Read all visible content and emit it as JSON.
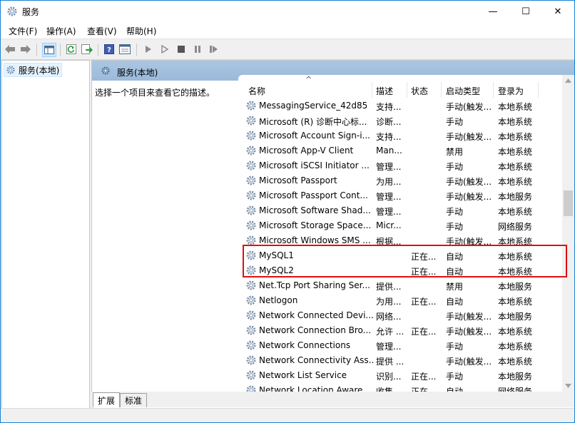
{
  "window": {
    "title": "服务",
    "minimize_glyph": "—",
    "maximize_glyph": "☐",
    "close_glyph": "✕"
  },
  "menu": [
    "文件(F)",
    "操作(A)",
    "查看(V)",
    "帮助(H)"
  ],
  "tree": {
    "item": "服务(本地)"
  },
  "pane": {
    "header": "服务(本地)",
    "description": "选择一个项目来查看它的描述。"
  },
  "columns": {
    "name": "名称",
    "desc": "描述",
    "status": "状态",
    "startup": "启动类型",
    "login": "登录为",
    "sort_glyph": "^"
  },
  "services": [
    {
      "name": "MessagingService_42d85",
      "desc": "支持...",
      "status": "",
      "startup": "手动(触发...",
      "login": "本地系统"
    },
    {
      "name": "Microsoft (R) 诊断中心标...",
      "desc": "诊断...",
      "status": "",
      "startup": "手动",
      "login": "本地系统"
    },
    {
      "name": "Microsoft Account Sign-i...",
      "desc": "支持...",
      "status": "",
      "startup": "手动(触发...",
      "login": "本地系统"
    },
    {
      "name": "Microsoft App-V Client",
      "desc": "Man...",
      "status": "",
      "startup": "禁用",
      "login": "本地系统"
    },
    {
      "name": "Microsoft iSCSI Initiator ...",
      "desc": "管理...",
      "status": "",
      "startup": "手动",
      "login": "本地系统"
    },
    {
      "name": "Microsoft Passport",
      "desc": "为用...",
      "status": "",
      "startup": "手动(触发...",
      "login": "本地系统"
    },
    {
      "name": "Microsoft Passport Cont...",
      "desc": "管理...",
      "status": "",
      "startup": "手动(触发...",
      "login": "本地服务"
    },
    {
      "name": "Microsoft Software Shad...",
      "desc": "管理...",
      "status": "",
      "startup": "手动",
      "login": "本地系统"
    },
    {
      "name": "Microsoft Storage Space...",
      "desc": "Micr...",
      "status": "",
      "startup": "手动",
      "login": "网络服务"
    },
    {
      "name": "Microsoft Windows SMS ...",
      "desc": "根据...",
      "status": "",
      "startup": "手动(触发...",
      "login": "本地系统"
    },
    {
      "name": "MySQL1",
      "desc": "",
      "status": "正在...",
      "startup": "自动",
      "login": "本地系统"
    },
    {
      "name": "MySQL2",
      "desc": "",
      "status": "正在...",
      "startup": "自动",
      "login": "本地系统"
    },
    {
      "name": "Net.Tcp Port Sharing Ser...",
      "desc": "提供...",
      "status": "",
      "startup": "禁用",
      "login": "本地服务"
    },
    {
      "name": "Netlogon",
      "desc": "为用...",
      "status": "正在...",
      "startup": "自动",
      "login": "本地系统"
    },
    {
      "name": "Network Connected Devi...",
      "desc": "网络...",
      "status": "",
      "startup": "手动(触发...",
      "login": "本地服务"
    },
    {
      "name": "Network Connection Bro...",
      "desc": "允许 ...",
      "status": "正在...",
      "startup": "手动(触发...",
      "login": "本地系统"
    },
    {
      "name": "Network Connections",
      "desc": "管理...",
      "status": "",
      "startup": "手动",
      "login": "本地系统"
    },
    {
      "name": "Network Connectivity Ass...",
      "desc": "提供 ...",
      "status": "",
      "startup": "手动(触发...",
      "login": "本地系统"
    },
    {
      "name": "Network List Service",
      "desc": "识别...",
      "status": "正在...",
      "startup": "手动",
      "login": "本地服务"
    },
    {
      "name": "Network Location Aware...",
      "desc": "收集...",
      "status": "正在...",
      "startup": "自动",
      "login": "网络服务"
    }
  ],
  "tabs": [
    "扩展",
    "标准"
  ],
  "colors": {
    "highlight_border": "#e01010",
    "pane_header": "#aac6e3"
  }
}
